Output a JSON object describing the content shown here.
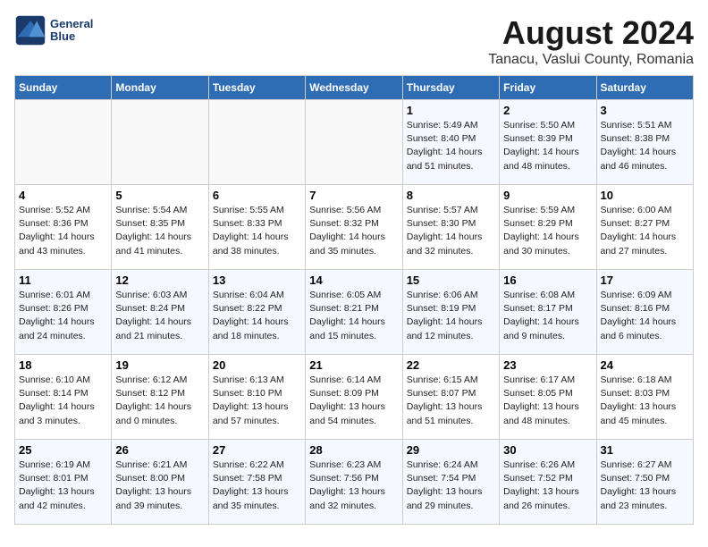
{
  "header": {
    "logo_line1": "General",
    "logo_line2": "Blue",
    "main_title": "August 2024",
    "subtitle": "Tanacu, Vaslui County, Romania"
  },
  "days_of_week": [
    "Sunday",
    "Monday",
    "Tuesday",
    "Wednesday",
    "Thursday",
    "Friday",
    "Saturday"
  ],
  "weeks": [
    [
      {
        "num": "",
        "info": ""
      },
      {
        "num": "",
        "info": ""
      },
      {
        "num": "",
        "info": ""
      },
      {
        "num": "",
        "info": ""
      },
      {
        "num": "1",
        "info": "Sunrise: 5:49 AM\nSunset: 8:40 PM\nDaylight: 14 hours\nand 51 minutes."
      },
      {
        "num": "2",
        "info": "Sunrise: 5:50 AM\nSunset: 8:39 PM\nDaylight: 14 hours\nand 48 minutes."
      },
      {
        "num": "3",
        "info": "Sunrise: 5:51 AM\nSunset: 8:38 PM\nDaylight: 14 hours\nand 46 minutes."
      }
    ],
    [
      {
        "num": "4",
        "info": "Sunrise: 5:52 AM\nSunset: 8:36 PM\nDaylight: 14 hours\nand 43 minutes."
      },
      {
        "num": "5",
        "info": "Sunrise: 5:54 AM\nSunset: 8:35 PM\nDaylight: 14 hours\nand 41 minutes."
      },
      {
        "num": "6",
        "info": "Sunrise: 5:55 AM\nSunset: 8:33 PM\nDaylight: 14 hours\nand 38 minutes."
      },
      {
        "num": "7",
        "info": "Sunrise: 5:56 AM\nSunset: 8:32 PM\nDaylight: 14 hours\nand 35 minutes."
      },
      {
        "num": "8",
        "info": "Sunrise: 5:57 AM\nSunset: 8:30 PM\nDaylight: 14 hours\nand 32 minutes."
      },
      {
        "num": "9",
        "info": "Sunrise: 5:59 AM\nSunset: 8:29 PM\nDaylight: 14 hours\nand 30 minutes."
      },
      {
        "num": "10",
        "info": "Sunrise: 6:00 AM\nSunset: 8:27 PM\nDaylight: 14 hours\nand 27 minutes."
      }
    ],
    [
      {
        "num": "11",
        "info": "Sunrise: 6:01 AM\nSunset: 8:26 PM\nDaylight: 14 hours\nand 24 minutes."
      },
      {
        "num": "12",
        "info": "Sunrise: 6:03 AM\nSunset: 8:24 PM\nDaylight: 14 hours\nand 21 minutes."
      },
      {
        "num": "13",
        "info": "Sunrise: 6:04 AM\nSunset: 8:22 PM\nDaylight: 14 hours\nand 18 minutes."
      },
      {
        "num": "14",
        "info": "Sunrise: 6:05 AM\nSunset: 8:21 PM\nDaylight: 14 hours\nand 15 minutes."
      },
      {
        "num": "15",
        "info": "Sunrise: 6:06 AM\nSunset: 8:19 PM\nDaylight: 14 hours\nand 12 minutes."
      },
      {
        "num": "16",
        "info": "Sunrise: 6:08 AM\nSunset: 8:17 PM\nDaylight: 14 hours\nand 9 minutes."
      },
      {
        "num": "17",
        "info": "Sunrise: 6:09 AM\nSunset: 8:16 PM\nDaylight: 14 hours\nand 6 minutes."
      }
    ],
    [
      {
        "num": "18",
        "info": "Sunrise: 6:10 AM\nSunset: 8:14 PM\nDaylight: 14 hours\nand 3 minutes."
      },
      {
        "num": "19",
        "info": "Sunrise: 6:12 AM\nSunset: 8:12 PM\nDaylight: 14 hours\nand 0 minutes."
      },
      {
        "num": "20",
        "info": "Sunrise: 6:13 AM\nSunset: 8:10 PM\nDaylight: 13 hours\nand 57 minutes."
      },
      {
        "num": "21",
        "info": "Sunrise: 6:14 AM\nSunset: 8:09 PM\nDaylight: 13 hours\nand 54 minutes."
      },
      {
        "num": "22",
        "info": "Sunrise: 6:15 AM\nSunset: 8:07 PM\nDaylight: 13 hours\nand 51 minutes."
      },
      {
        "num": "23",
        "info": "Sunrise: 6:17 AM\nSunset: 8:05 PM\nDaylight: 13 hours\nand 48 minutes."
      },
      {
        "num": "24",
        "info": "Sunrise: 6:18 AM\nSunset: 8:03 PM\nDaylight: 13 hours\nand 45 minutes."
      }
    ],
    [
      {
        "num": "25",
        "info": "Sunrise: 6:19 AM\nSunset: 8:01 PM\nDaylight: 13 hours\nand 42 minutes."
      },
      {
        "num": "26",
        "info": "Sunrise: 6:21 AM\nSunset: 8:00 PM\nDaylight: 13 hours\nand 39 minutes."
      },
      {
        "num": "27",
        "info": "Sunrise: 6:22 AM\nSunset: 7:58 PM\nDaylight: 13 hours\nand 35 minutes."
      },
      {
        "num": "28",
        "info": "Sunrise: 6:23 AM\nSunset: 7:56 PM\nDaylight: 13 hours\nand 32 minutes."
      },
      {
        "num": "29",
        "info": "Sunrise: 6:24 AM\nSunset: 7:54 PM\nDaylight: 13 hours\nand 29 minutes."
      },
      {
        "num": "30",
        "info": "Sunrise: 6:26 AM\nSunset: 7:52 PM\nDaylight: 13 hours\nand 26 minutes."
      },
      {
        "num": "31",
        "info": "Sunrise: 6:27 AM\nSunset: 7:50 PM\nDaylight: 13 hours\nand 23 minutes."
      }
    ]
  ]
}
